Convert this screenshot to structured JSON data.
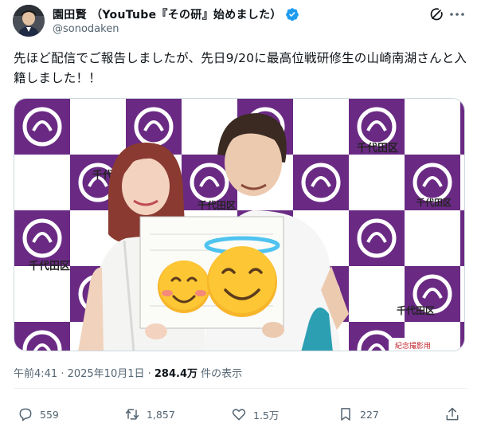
{
  "author": {
    "display_name": "園田賢 （YouTube『その研』始めました）",
    "handle": "@sonodaken",
    "verified_color": "#1d9bf0"
  },
  "tweet": {
    "text": "先ほど配信でご報告しましたが、先日9/20に最高位戦研修生の山崎南湖さんと入籍しました！！"
  },
  "photo": {
    "sign_text": "千代田区",
    "sign_sub": "Chiyoda",
    "board_text": "紀念撮影用",
    "backdrop_color": "#6a2a84"
  },
  "meta": {
    "timestamp": "午前4:41 · 2025年10月1日 · ",
    "views": "284.4万",
    "views_suffix": " 件の表示"
  },
  "actions": {
    "replies": "559",
    "reposts": "1,857",
    "likes": "1.5万",
    "bookmarks": "227"
  },
  "icons": [
    "avatar",
    "verified-icon",
    "grok-icon",
    "more-icon",
    "reply-icon",
    "repost-icon",
    "like-icon",
    "bookmark-icon",
    "share-icon"
  ]
}
